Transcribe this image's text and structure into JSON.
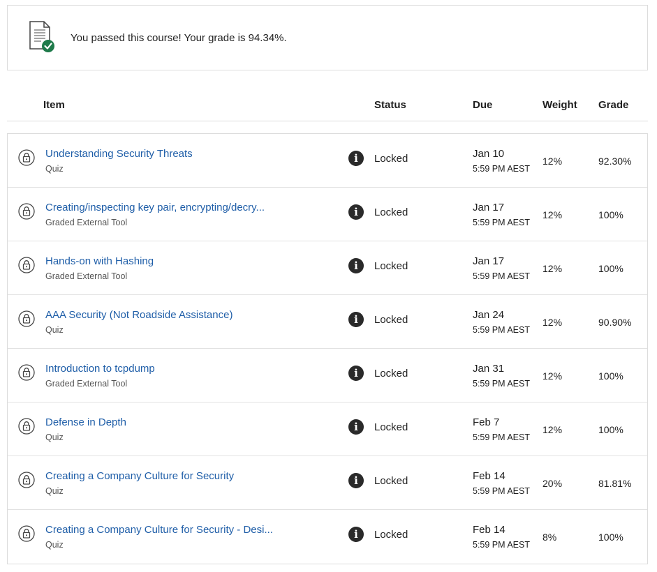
{
  "banner": {
    "message": "You passed this course! Your grade is 94.34%.",
    "icon": "document-check-icon",
    "accent": "#1e7a4a"
  },
  "columns": {
    "item": "Item",
    "status": "Status",
    "due": "Due",
    "weight": "Weight",
    "grade": "Grade"
  },
  "colors": {
    "link": "#1f5ea8",
    "info_icon_bg": "#2a2a2a"
  },
  "rows": [
    {
      "title": "Understanding Security Threats",
      "type": "Quiz",
      "status": "Locked",
      "due_date": "Jan 10",
      "due_time": "5:59 PM AEST",
      "weight": "12%",
      "grade": "92.30%"
    },
    {
      "title": "Creating/inspecting key pair, encrypting/decry...",
      "type": "Graded External Tool",
      "status": "Locked",
      "due_date": "Jan 17",
      "due_time": "5:59 PM AEST",
      "weight": "12%",
      "grade": "100%"
    },
    {
      "title": "Hands-on with Hashing",
      "type": "Graded External Tool",
      "status": "Locked",
      "due_date": "Jan 17",
      "due_time": "5:59 PM AEST",
      "weight": "12%",
      "grade": "100%"
    },
    {
      "title": "AAA Security (Not Roadside Assistance)",
      "type": "Quiz",
      "status": "Locked",
      "due_date": "Jan 24",
      "due_time": "5:59 PM AEST",
      "weight": "12%",
      "grade": "90.90%"
    },
    {
      "title": "Introduction to tcpdump",
      "type": "Graded External Tool",
      "status": "Locked",
      "due_date": "Jan 31",
      "due_time": "5:59 PM AEST",
      "weight": "12%",
      "grade": "100%"
    },
    {
      "title": "Defense in Depth",
      "type": "Quiz",
      "status": "Locked",
      "due_date": "Feb 7",
      "due_time": "5:59 PM AEST",
      "weight": "12%",
      "grade": "100%"
    },
    {
      "title": "Creating a Company Culture for Security",
      "type": "Quiz",
      "status": "Locked",
      "due_date": "Feb 14",
      "due_time": "5:59 PM AEST",
      "weight": "20%",
      "grade": "81.81%"
    },
    {
      "title": "Creating a Company Culture for Security - Desi...",
      "type": "Quiz",
      "status": "Locked",
      "due_date": "Feb 14",
      "due_time": "5:59 PM AEST",
      "weight": "8%",
      "grade": "100%"
    }
  ]
}
